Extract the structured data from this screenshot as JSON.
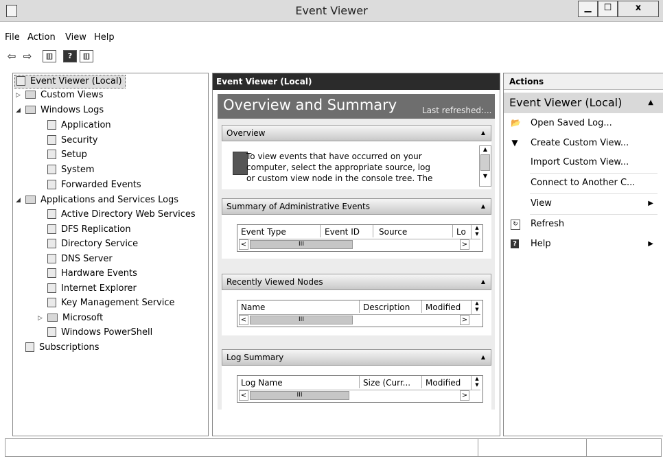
{
  "window": {
    "title": "Event Viewer",
    "min": "▁",
    "max": "☐",
    "close": "x"
  },
  "menu": [
    "File",
    "Action",
    "View",
    "Help"
  ],
  "toolbar": {
    "back": "⇦",
    "forward": "⇨",
    "help": "?"
  },
  "tree": {
    "root": "Event Viewer (Local)",
    "custom_views": "Custom Views",
    "windows_logs": "Windows Logs",
    "windows_logs_items": [
      "Application",
      "Security",
      "Setup",
      "System",
      "Forwarded Events"
    ],
    "apps_services": "Applications and Services Logs",
    "apps_items": [
      "Active Directory Web Services",
      "DFS Replication",
      "Directory Service",
      "DNS Server",
      "Hardware Events",
      "Internet Explorer",
      "Key Management Service"
    ],
    "microsoft": "Microsoft",
    "powershell": "Windows PowerShell",
    "subscriptions": "Subscriptions"
  },
  "center": {
    "header": "Event Viewer (Local)",
    "overview_title": "Overview and Summary",
    "last_refreshed": "Last refreshed:...",
    "overview_section": "Overview",
    "overview_text": [
      "To view events that have occurred on your",
      "computer, select the appropriate source, log",
      "or custom view node in the console tree. The"
    ],
    "summary_section": "Summary of Administrative Events",
    "summary_cols": [
      "Event Type",
      "Event ID",
      "Source",
      "Lo"
    ],
    "recent_section": "Recently Viewed Nodes",
    "recent_cols": [
      "Name",
      "Description",
      "Modified"
    ],
    "log_section": "Log Summary",
    "log_cols": [
      "Log Name",
      "Size (Curr...",
      "Modified"
    ],
    "thumb_glyph": "III"
  },
  "actions": {
    "header": "Actions",
    "group": "Event Viewer (Local)",
    "items": [
      "Open Saved Log...",
      "Create Custom View...",
      "Import Custom View...",
      "Connect to Another C...",
      "View",
      "Refresh",
      "Help"
    ]
  }
}
